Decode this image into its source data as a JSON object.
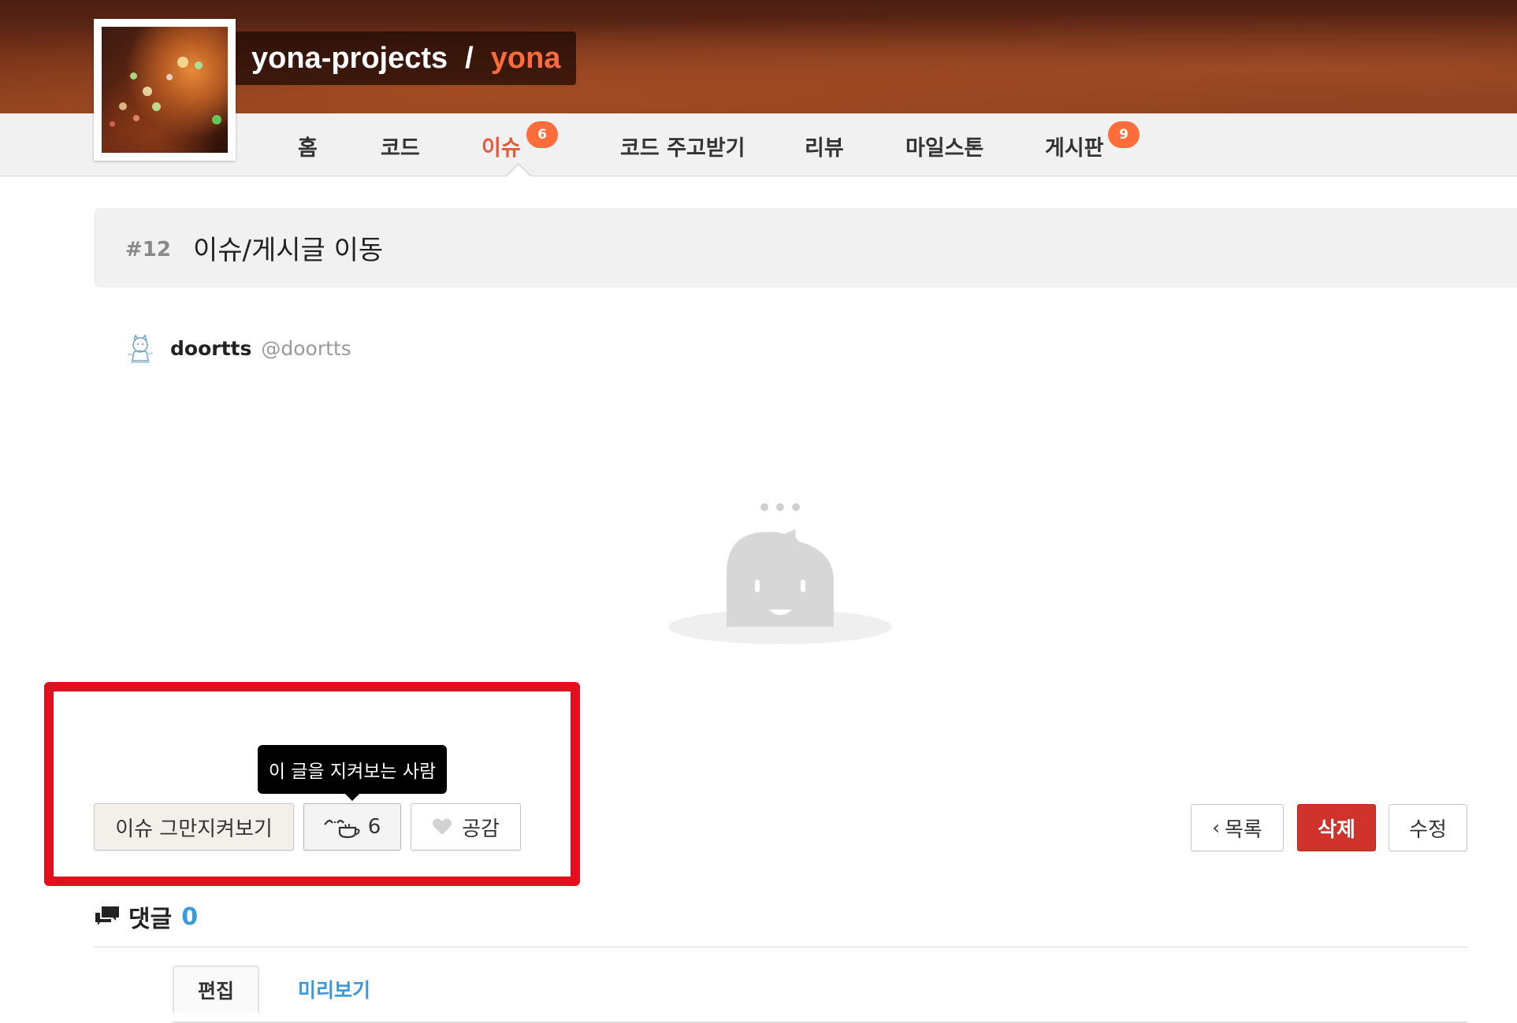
{
  "header": {
    "owner": "yona-projects",
    "separator": "/",
    "repo": "yona",
    "colors": {
      "repo": "#ff6b3d",
      "active_menu": "#e8563b",
      "badge": "#ff6d3a"
    }
  },
  "menu": {
    "items": [
      {
        "label": "홈"
      },
      {
        "label": "코드"
      },
      {
        "label": "이슈",
        "badge": "6",
        "active": true
      },
      {
        "label": "코드 주고받기"
      },
      {
        "label": "리뷰"
      },
      {
        "label": "마일스톤"
      },
      {
        "label": "게시판",
        "badge": "9"
      }
    ]
  },
  "issue": {
    "number": "#12",
    "title": "이슈/게시글 이동"
  },
  "author": {
    "name": "doortts",
    "login": "@doortts"
  },
  "actions": {
    "unwatch_label": "이슈 그만지켜보기",
    "watchers_count": "6",
    "watchers_tooltip": "이 글을 지켜보는 사람",
    "like_label": "공감",
    "list_label": "목록",
    "delete_label": "삭제",
    "edit_label": "수정",
    "delete_color": "#d0322c"
  },
  "comments": {
    "label": "댓글",
    "count": "0",
    "tabs": [
      {
        "label": "편집",
        "active": true
      },
      {
        "label": "미리보기"
      }
    ],
    "count_color": "#3a9ad9"
  }
}
